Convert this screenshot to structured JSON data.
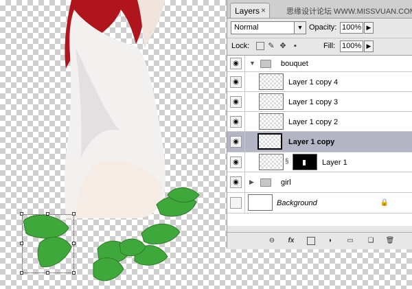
{
  "panel": {
    "tab_label": "Layers",
    "tab_close": "×",
    "watermark": "思缘设计论坛 WWW.MISSVUAN.COM",
    "blend_mode": "Normal",
    "opacity_label": "Opacity:",
    "opacity_value": "100%",
    "lock_label": "Lock:",
    "fill_label": "Fill:",
    "fill_value": "100%"
  },
  "layers": [
    {
      "name": "bouquet",
      "type": "group",
      "expanded": true,
      "visible": true
    },
    {
      "name": "Layer 1 copy 4",
      "type": "layer",
      "visible": true
    },
    {
      "name": "Layer 1 copy 3",
      "type": "layer",
      "visible": true
    },
    {
      "name": "Layer 1 copy 2",
      "type": "layer",
      "visible": true
    },
    {
      "name": "Layer 1 copy",
      "type": "layer",
      "visible": true,
      "selected": true
    },
    {
      "name": "Layer 1",
      "type": "layer",
      "visible": true,
      "has_mask": true
    },
    {
      "name": "girl",
      "type": "group",
      "expanded": false,
      "visible": true
    },
    {
      "name": "Background",
      "type": "background",
      "visible": false,
      "locked": true
    }
  ],
  "bottom_icons": [
    "link-icon",
    "fx-icon",
    "mask-icon",
    "adjustment-icon",
    "group-icon",
    "new-layer-icon",
    "trash-icon"
  ],
  "colors": {
    "selected_row": "#b4b6c5",
    "panel_bg": "#e7e7e7",
    "leaf_green": "#3fa83a"
  }
}
